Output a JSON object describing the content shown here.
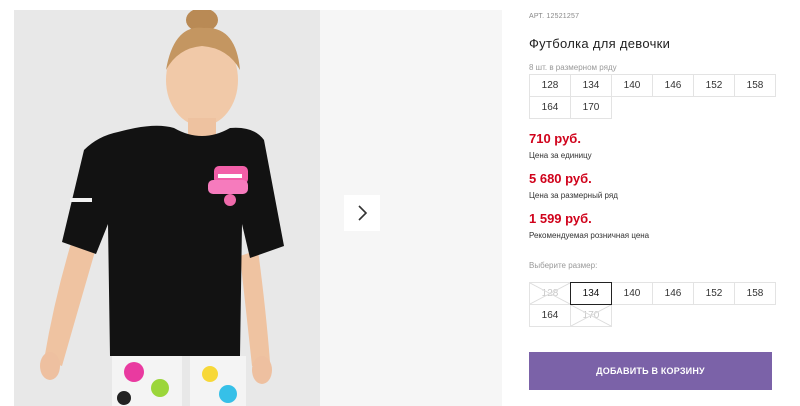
{
  "product": {
    "sku": "АРТ. 12521257",
    "title": "Футболка для девочки",
    "image_alt": "Photo of a girl in a black t-shirt"
  },
  "pack": {
    "note": "8 шт. в размерном ряду",
    "sizes": [
      "128",
      "134",
      "140",
      "146",
      "152",
      "158",
      "164",
      "170"
    ]
  },
  "prices": {
    "unit_price": "710 руб.",
    "unit_label": "Цена за единицу",
    "pack_price": "5 680 руб.",
    "pack_label": "Цена за размерный ряд",
    "retail_price": "1 599 руб.",
    "retail_label": "Рекомендуемая розничная цена"
  },
  "choose": {
    "label": "Выберите размер:",
    "sizes": [
      {
        "label": "128",
        "available": false,
        "selected": false
      },
      {
        "label": "134",
        "available": true,
        "selected": true
      },
      {
        "label": "140",
        "available": true,
        "selected": false
      },
      {
        "label": "146",
        "available": true,
        "selected": false
      },
      {
        "label": "152",
        "available": true,
        "selected": false
      },
      {
        "label": "158",
        "available": true,
        "selected": false
      },
      {
        "label": "164",
        "available": true,
        "selected": false
      },
      {
        "label": "170",
        "available": false,
        "selected": false
      }
    ]
  },
  "cart_button": "ДОБАВИТЬ В КОРЗИНУ",
  "colors": {
    "price": "#d0021b",
    "accent": "#7b62a8"
  },
  "icons": {
    "next": "chevron-right-icon"
  }
}
